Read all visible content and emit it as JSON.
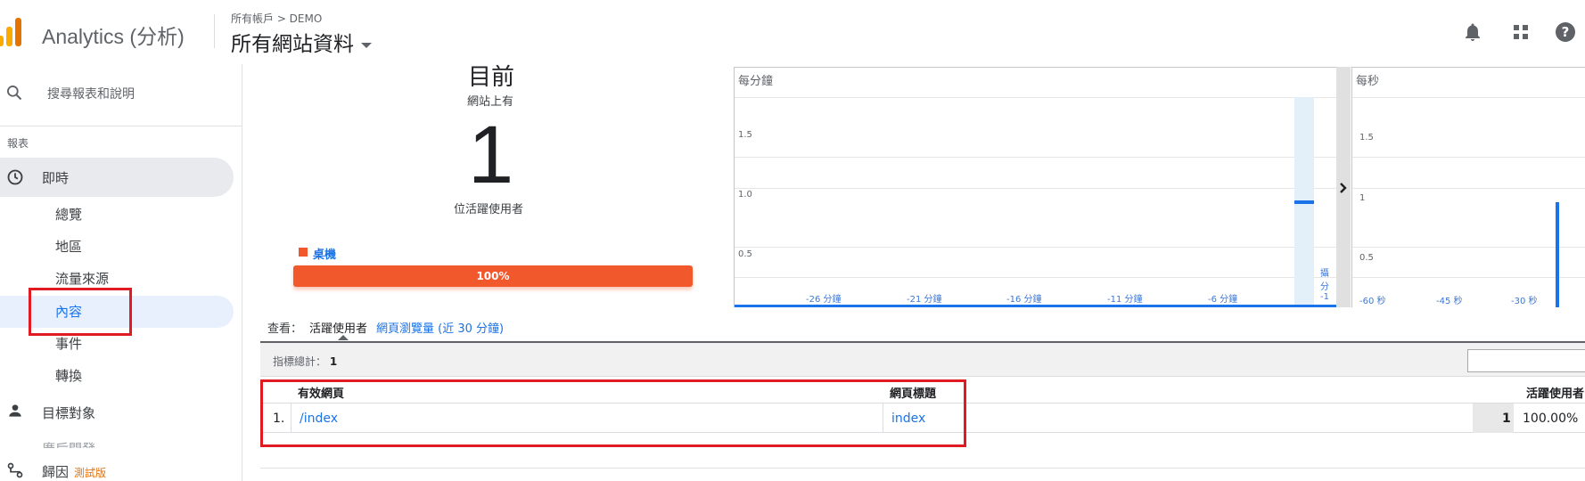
{
  "header": {
    "app_name": "Analytics (分析)",
    "breadcrumb": "所有帳戶 > DEMO",
    "property": "所有網站資料",
    "icons": [
      "bell-icon",
      "apps-grid-icon",
      "help-icon"
    ]
  },
  "sidebar": {
    "search_placeholder": "搜尋報表和說明",
    "section_label": "報表",
    "realtime_label": "即時",
    "sub_items": [
      "總覽",
      "地區",
      "流量來源",
      "內容",
      "事件",
      "轉換"
    ],
    "active_sub_item": "內容",
    "audience_label": "目標對象",
    "cut_item_label": "廣后開發",
    "attribution_label": "歸因",
    "beta_label": "測試版"
  },
  "realtime": {
    "now_label": "目前",
    "on_site_label": "網站上有",
    "active_users_count": "1",
    "active_users_label": "位活躍使用者",
    "device_label": "桌機",
    "device_percent": "100%",
    "device_fraction": 1.0,
    "colors": {
      "device": "#f1582c",
      "chart": "#1a73e8",
      "highlight": "#e01b24"
    }
  },
  "chart_data": [
    {
      "type": "bar",
      "title": "每分鐘",
      "x_ticks": [
        "-26 分鐘",
        "-21 分鐘",
        "-16 分鐘",
        "-11 分鐘",
        "-6 分鐘"
      ],
      "y_ticks": [
        "1.5",
        "1.0",
        "0.5"
      ],
      "last_label": [
        "攝",
        "分",
        "-1"
      ],
      "values": [
        {
          "x": "-1 分鐘",
          "y": 1
        }
      ],
      "ylim": [
        0,
        2
      ],
      "grid": true
    },
    {
      "type": "bar",
      "title": "每秒",
      "x_ticks": [
        "-60 秒",
        "-45 秒",
        "-30 秒"
      ],
      "y_ticks": [
        "1.5",
        "1",
        "0.5"
      ],
      "values": [
        {
          "x": "-17 秒",
          "y": 1
        }
      ],
      "ylim": [
        0,
        2
      ],
      "grid": true
    }
  ],
  "view": {
    "label": "查看：",
    "option_active": "活躍使用者",
    "option_link": "網頁瀏覽量 (近 30 分鐘)"
  },
  "table": {
    "summary_label": "指標總計：",
    "summary_value": "1",
    "headers": {
      "page": "有效網頁",
      "title": "網頁標題",
      "users": "活躍使用者"
    },
    "rows": [
      {
        "index": "1.",
        "page": "/index",
        "title": "index",
        "users": "1",
        "percent": "100.00%"
      }
    ]
  }
}
